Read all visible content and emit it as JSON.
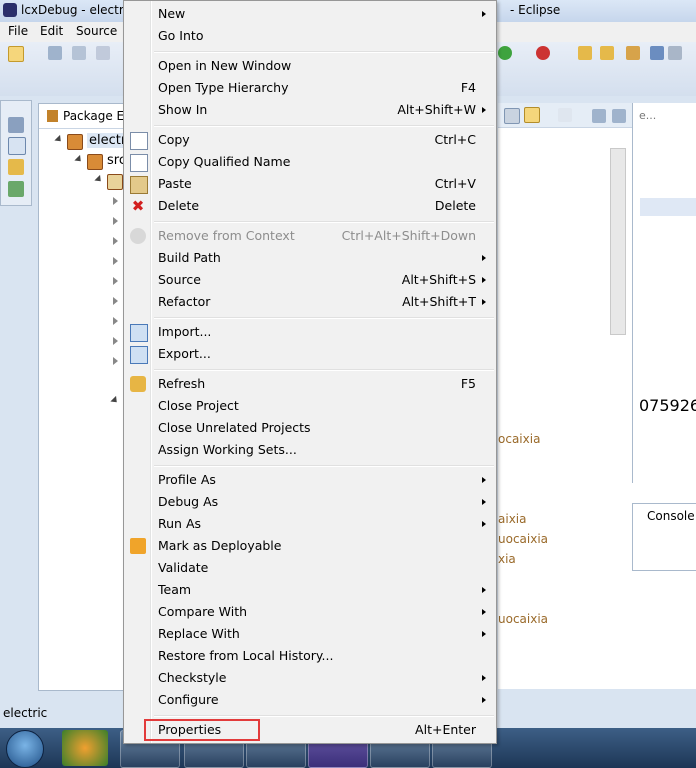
{
  "window": {
    "title_left": "lcxDebug - electri",
    "title_right": "- Eclipse",
    "title_blurred": "—— ———"
  },
  "menubar": [
    "File",
    "Edit",
    "Source"
  ],
  "package_explorer": {
    "tab_label": "Package Exp",
    "project": "electri",
    "src": "src"
  },
  "right_panel": {
    "number": "075926",
    "texts": [
      "ocaixia",
      "aixia",
      "uocaixia",
      "xia",
      "uocaixia"
    ],
    "console_tab": "Console",
    "ellipsis": "e..."
  },
  "status_bar": {
    "text": "electric"
  },
  "context_menu": {
    "items": [
      {
        "label": "New",
        "shortcut": "",
        "submenu": true,
        "disabled": false,
        "icon": ""
      },
      {
        "label": "Go Into",
        "shortcut": "",
        "submenu": false,
        "disabled": false,
        "icon": ""
      },
      {
        "label": "Open in New Window",
        "shortcut": "",
        "submenu": false,
        "disabled": false,
        "icon": ""
      },
      {
        "label": "Open Type Hierarchy",
        "shortcut": "F4",
        "submenu": false,
        "disabled": false,
        "icon": ""
      },
      {
        "label": "Show In",
        "shortcut": "Alt+Shift+W",
        "submenu": true,
        "disabled": false,
        "icon": ""
      },
      {
        "label": "Copy",
        "shortcut": "Ctrl+C",
        "submenu": false,
        "disabled": false,
        "icon": "copy-icon"
      },
      {
        "label": "Copy Qualified Name",
        "shortcut": "",
        "submenu": false,
        "disabled": false,
        "icon": "copy-icon"
      },
      {
        "label": "Paste",
        "shortcut": "Ctrl+V",
        "submenu": false,
        "disabled": false,
        "icon": "paste-icon"
      },
      {
        "label": "Delete",
        "shortcut": "Delete",
        "submenu": false,
        "disabled": false,
        "icon": "delete-icon"
      },
      {
        "label": "Remove from Context",
        "shortcut": "Ctrl+Alt+Shift+Down",
        "submenu": false,
        "disabled": true,
        "icon": "remove-context-icon"
      },
      {
        "label": "Build Path",
        "shortcut": "",
        "submenu": true,
        "disabled": false,
        "icon": ""
      },
      {
        "label": "Source",
        "shortcut": "Alt+Shift+S",
        "submenu": true,
        "disabled": false,
        "icon": ""
      },
      {
        "label": "Refactor",
        "shortcut": "Alt+Shift+T",
        "submenu": true,
        "disabled": false,
        "icon": ""
      },
      {
        "label": "Import...",
        "shortcut": "",
        "submenu": false,
        "disabled": false,
        "icon": "import-icon"
      },
      {
        "label": "Export...",
        "shortcut": "",
        "submenu": false,
        "disabled": false,
        "icon": "export-icon"
      },
      {
        "label": "Refresh",
        "shortcut": "F5",
        "submenu": false,
        "disabled": false,
        "icon": "refresh-icon"
      },
      {
        "label": "Close Project",
        "shortcut": "",
        "submenu": false,
        "disabled": false,
        "icon": ""
      },
      {
        "label": "Close Unrelated Projects",
        "shortcut": "",
        "submenu": false,
        "disabled": false,
        "icon": ""
      },
      {
        "label": "Assign Working Sets...",
        "shortcut": "",
        "submenu": false,
        "disabled": false,
        "icon": ""
      },
      {
        "label": "Profile As",
        "shortcut": "",
        "submenu": true,
        "disabled": false,
        "icon": ""
      },
      {
        "label": "Debug As",
        "shortcut": "",
        "submenu": true,
        "disabled": false,
        "icon": ""
      },
      {
        "label": "Run As",
        "shortcut": "",
        "submenu": true,
        "disabled": false,
        "icon": ""
      },
      {
        "label": "Mark as Deployable",
        "shortcut": "",
        "submenu": false,
        "disabled": false,
        "icon": "deploy-icon"
      },
      {
        "label": "Validate",
        "shortcut": "",
        "submenu": false,
        "disabled": false,
        "icon": ""
      },
      {
        "label": "Team",
        "shortcut": "",
        "submenu": true,
        "disabled": false,
        "icon": ""
      },
      {
        "label": "Compare With",
        "shortcut": "",
        "submenu": true,
        "disabled": false,
        "icon": ""
      },
      {
        "label": "Replace With",
        "shortcut": "",
        "submenu": true,
        "disabled": false,
        "icon": ""
      },
      {
        "label": "Restore from Local History...",
        "shortcut": "",
        "submenu": false,
        "disabled": false,
        "icon": ""
      },
      {
        "label": "Checkstyle",
        "shortcut": "",
        "submenu": true,
        "disabled": false,
        "icon": ""
      },
      {
        "label": "Configure",
        "shortcut": "",
        "submenu": true,
        "disabled": false,
        "icon": ""
      },
      {
        "label": "Properties",
        "shortcut": "Alt+Enter",
        "submenu": false,
        "disabled": false,
        "icon": "",
        "highlighted": true
      }
    ]
  },
  "colors": {
    "highlight_box": "#e23b3b",
    "menu_bg": "#f1f1f1",
    "console_text": "#9a6a2a"
  }
}
